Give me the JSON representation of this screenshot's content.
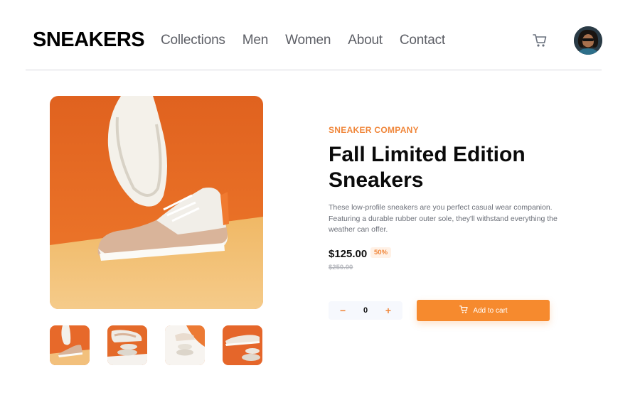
{
  "brand": {
    "logo": "SNEAKERS"
  },
  "nav": {
    "items": [
      {
        "label": "Collections"
      },
      {
        "label": "Men"
      },
      {
        "label": "Women"
      },
      {
        "label": "About"
      },
      {
        "label": "Contact"
      }
    ]
  },
  "header": {
    "cart_icon": "cart-icon",
    "avatar_icon": "user-avatar"
  },
  "product": {
    "company": "SNEAKER COMPANY",
    "title": "Fall Limited Edition Sneakers",
    "description": "These low-profile sneakers are you perfect casual wear companion. Featuring a durable rubber outer sole, they'll withstand everything the weather can offer.",
    "price": "$125.00",
    "discount": "50%",
    "old_price": "$250.00",
    "quantity": "0",
    "decrement_symbol": "−",
    "increment_symbol": "+",
    "add_to_cart_label": "Add to cart"
  },
  "gallery": {
    "thumbnail_count": 4
  },
  "colors": {
    "accent": "#f68a2e",
    "accent_light": "#fff1e6",
    "text_dark": "#1d2026",
    "text_muted": "#6b6f78"
  }
}
